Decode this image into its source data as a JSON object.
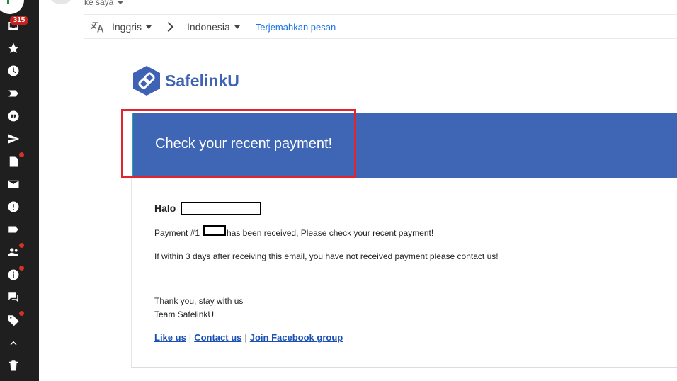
{
  "rail": {
    "badge_count": "315",
    "icons": [
      "inbox-icon",
      "star-icon",
      "clock-icon",
      "label-important-icon",
      "quote-icon",
      "send-icon",
      "draft-icon",
      "mail-icon",
      "spam-icon",
      "label-icon",
      "people-icon",
      "info-icon",
      "forum-icon",
      "tag-icon",
      "chevron-up-icon",
      "trash-icon"
    ]
  },
  "header": {
    "to_text": "ke saya"
  },
  "translate": {
    "source_lang": "Inggris",
    "target_lang": "Indonesia",
    "action": "Terjemahkan pesan"
  },
  "email": {
    "brand": "SafelinkU",
    "banner_title": "Check your recent payment!",
    "greeting": "Halo",
    "payment_line_prefix": "Payment #1",
    "payment_line_suffix": "has been received, Please check your recent payment!",
    "contact_line": "If within 3 days after receiving this email, you have not received payment please contact us!",
    "sign_line1": "Thank you, stay with us",
    "sign_line2": "Team SafelinkU",
    "links": {
      "like": "Like us",
      "separator": "|",
      "contact": "Contact us",
      "facebook": "Join Facebook group"
    }
  },
  "colors": {
    "banner": "#3e66b5",
    "brand": "#3f63b4",
    "highlight": "#e0252e",
    "link": "#1a4fb3"
  }
}
